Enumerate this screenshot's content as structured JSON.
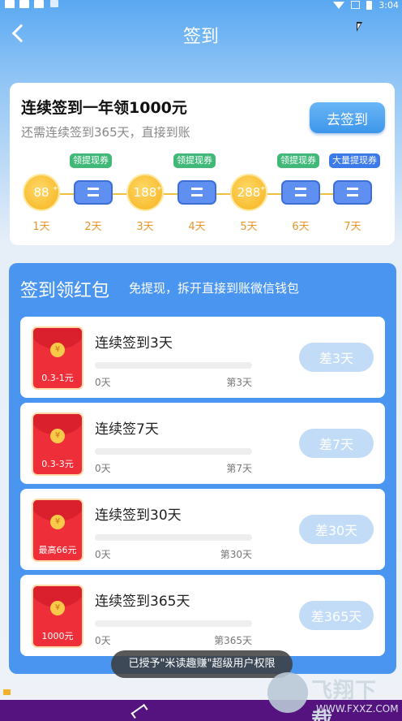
{
  "status_bar": {
    "time": "3:04"
  },
  "header": {
    "title": "签到"
  },
  "signin": {
    "title": "连续签到一年领1000元",
    "subtitle": "还需连续签到365天，直接到账",
    "button_label": "去签到",
    "days": [
      {
        "label": "1天",
        "kind": "coin",
        "value": "88",
        "tag": ""
      },
      {
        "label": "2天",
        "kind": "ticket",
        "value": "",
        "tag": "领提现券",
        "tag_color": "#40b878"
      },
      {
        "label": "3天",
        "kind": "coin",
        "value": "188",
        "tag": ""
      },
      {
        "label": "4天",
        "kind": "ticket",
        "value": "",
        "tag": "领提现券",
        "tag_color": "#40b878"
      },
      {
        "label": "5天",
        "kind": "coin",
        "value": "288",
        "tag": ""
      },
      {
        "label": "6天",
        "kind": "ticket",
        "value": "",
        "tag": "领提现券",
        "tag_color": "#40b878"
      },
      {
        "label": "7天",
        "kind": "ticket",
        "value": "",
        "tag": "大量提现券",
        "tag_color": "#3b7ae8"
      }
    ]
  },
  "redpacket": {
    "title": "签到领红包",
    "subtitle": "免提现，拆开直接到账微信钱包",
    "seal_symbol": "¥",
    "rows": [
      {
        "title": "连续签到3天",
        "amount": "0.3-1元",
        "start": "0天",
        "end": "第3天",
        "button": "差3天",
        "progress": 0
      },
      {
        "title": "连续签7天",
        "amount": "0.3-3元",
        "start": "0天",
        "end": "第7天",
        "button": "差7天",
        "progress": 0
      },
      {
        "title": "连续签到30天",
        "amount": "最高66元",
        "start": "0天",
        "end": "第30天",
        "button": "差30天",
        "progress": 0
      },
      {
        "title": "连续签到365天",
        "amount": "1000元",
        "start": "0天",
        "end": "第365天",
        "button": "差365天",
        "progress": 0
      }
    ]
  },
  "toast": {
    "text": "已授予\"米读趣赚\"超级用户权限"
  },
  "watermark": {
    "text": "飞翔下载",
    "url": "WWW.FXXZ.COM"
  }
}
